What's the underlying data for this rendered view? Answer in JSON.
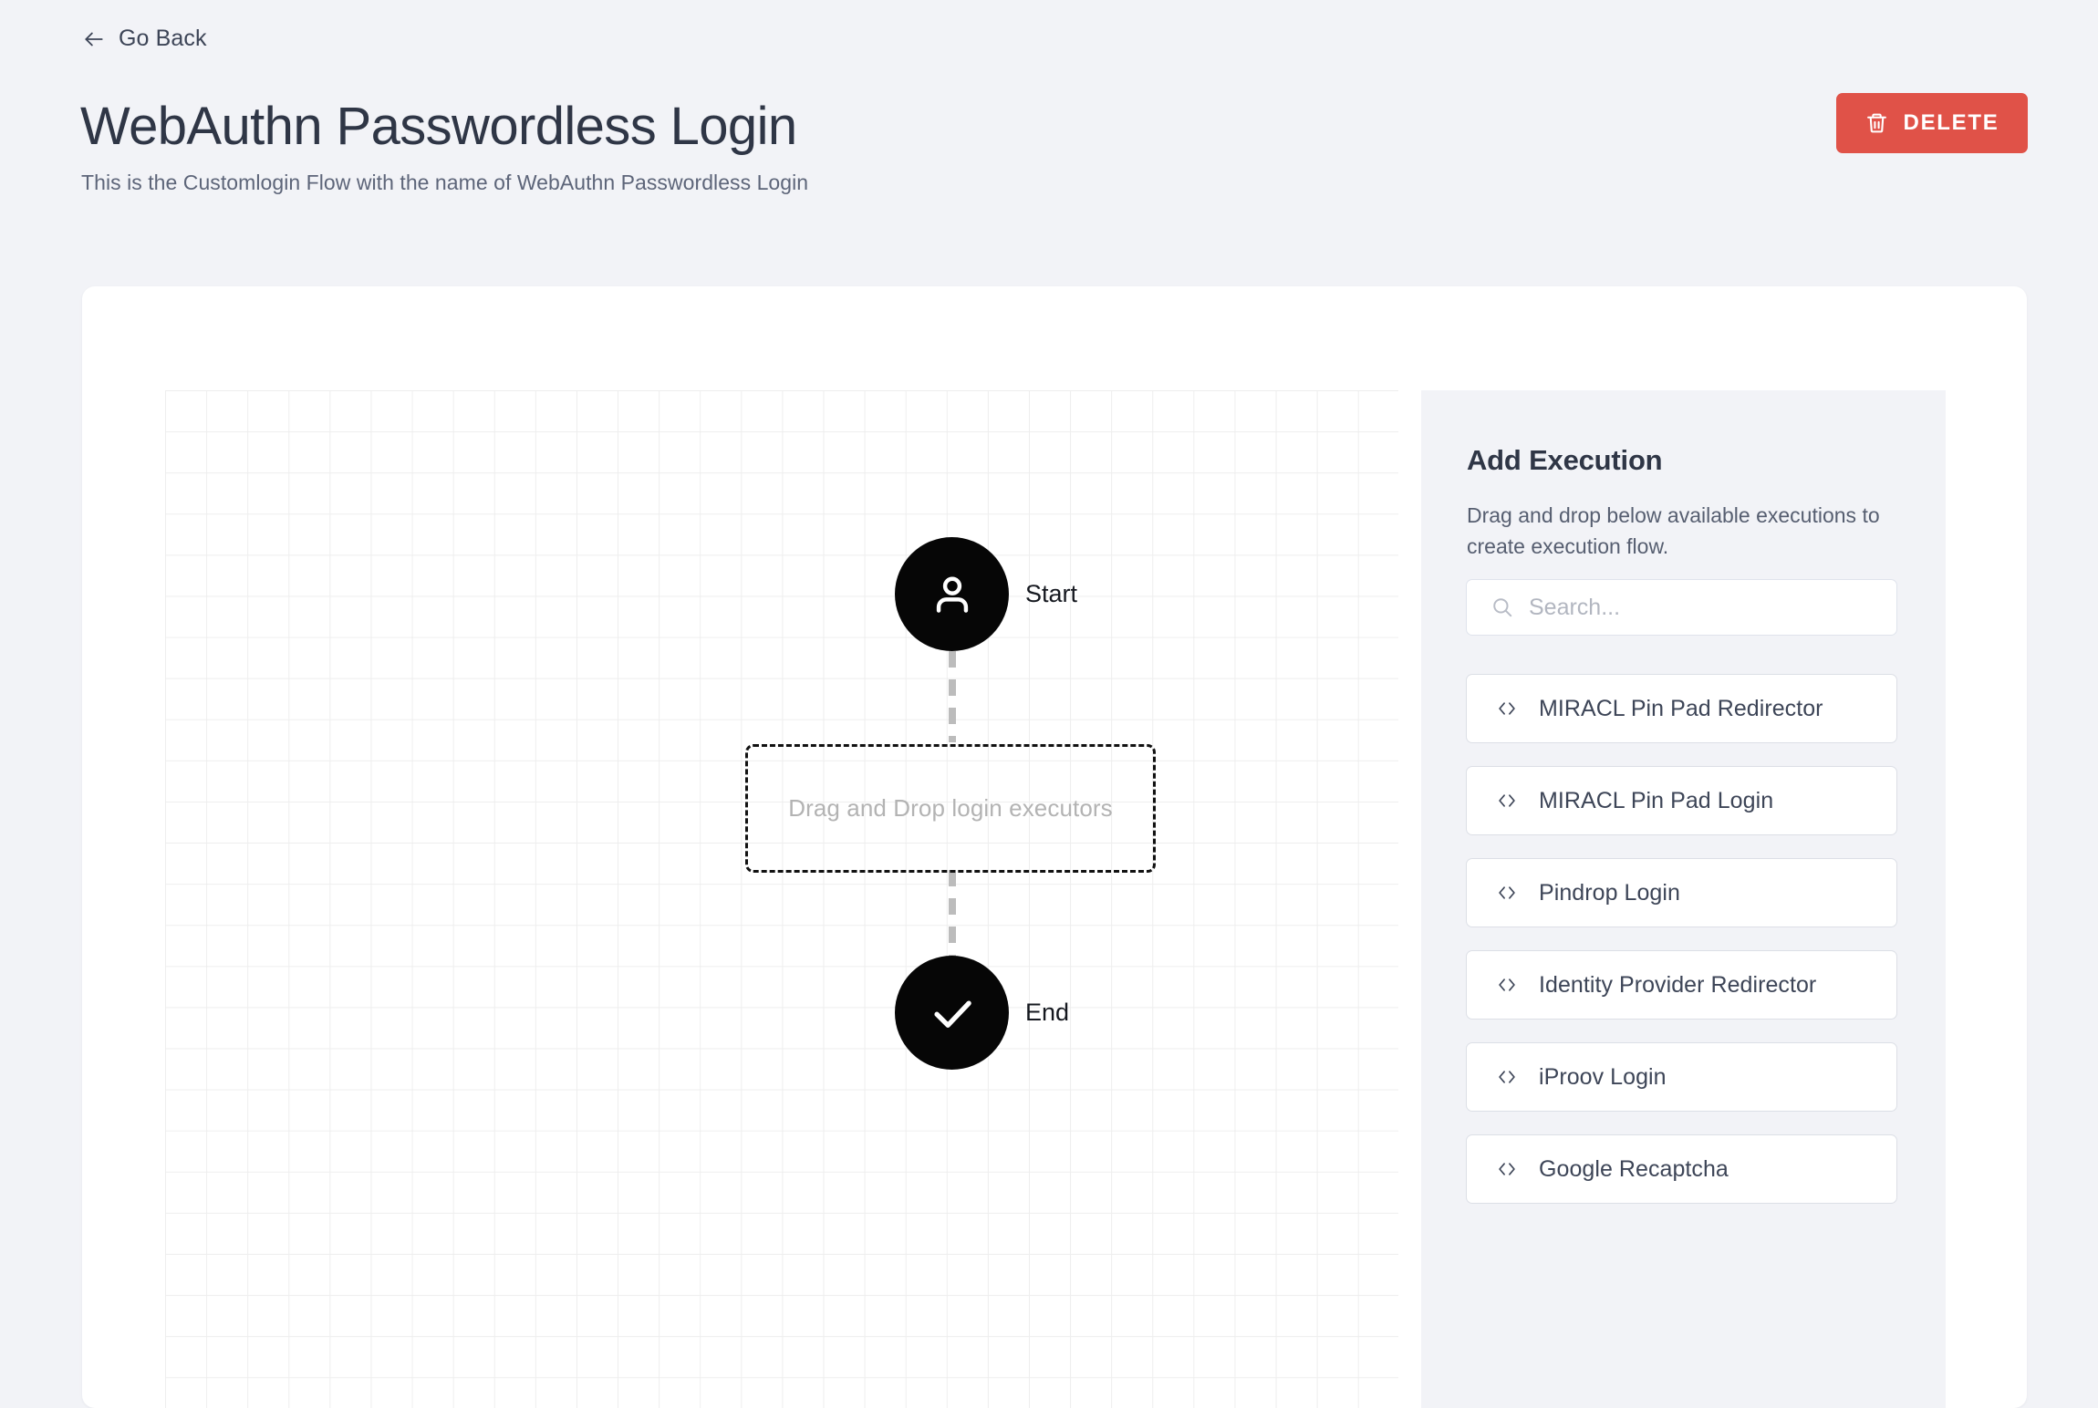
{
  "header": {
    "go_back_label": "Go Back",
    "title": "WebAuthn Passwordless Login",
    "subtitle": "This is the Customlogin Flow with the name of WebAuthn Passwordless Login",
    "delete_label": "DELETE",
    "delete_color": "#e05248"
  },
  "flow": {
    "start_label": "Start",
    "end_label": "End",
    "drop_zone_label": "Drag and Drop login executors",
    "node_color": "#060606",
    "connector_color": "#bcbcbc"
  },
  "panel": {
    "title": "Add Execution",
    "description": "Drag and drop below available executions to create execution flow.",
    "search_placeholder": "Search...",
    "search_value": "",
    "executions": [
      {
        "label": "MIRACL Pin Pad Redirector"
      },
      {
        "label": "MIRACL Pin Pad Login"
      },
      {
        "label": "Pindrop Login"
      },
      {
        "label": "Identity Provider Redirector"
      },
      {
        "label": "iProov Login"
      },
      {
        "label": "Google Recaptcha"
      }
    ]
  }
}
